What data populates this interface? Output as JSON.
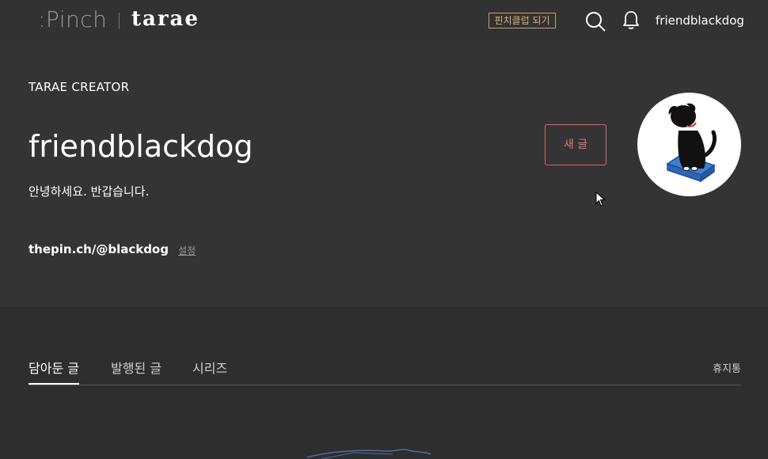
{
  "header": {
    "logo_primary": ":Pinch",
    "logo_secondary": "tarae",
    "club_button_label": "핀치클럽 되기",
    "search_icon": "search-icon",
    "notification_icon": "bell-icon",
    "username": "friendblackdog"
  },
  "profile": {
    "creator_label": "TARAE CREATOR",
    "name": "friendblackdog",
    "greeting": "안녕하세요. 반갑습니다.",
    "url": "thepin.ch/@blackdog",
    "settings_label": "설정",
    "new_post_label": "새 글",
    "avatar_icon": "black-dog-on-book-avatar"
  },
  "tabs": {
    "items": [
      {
        "label": "담아둔 글",
        "active": true
      },
      {
        "label": "발행된 글",
        "active": false
      },
      {
        "label": "시리즈",
        "active": false
      }
    ],
    "trash_label": "휴지통"
  },
  "colors": {
    "background": "#2e2e2e",
    "profile_background": "#343434",
    "accent_red": "#d9665e",
    "club_gold": "#c9a26a"
  }
}
